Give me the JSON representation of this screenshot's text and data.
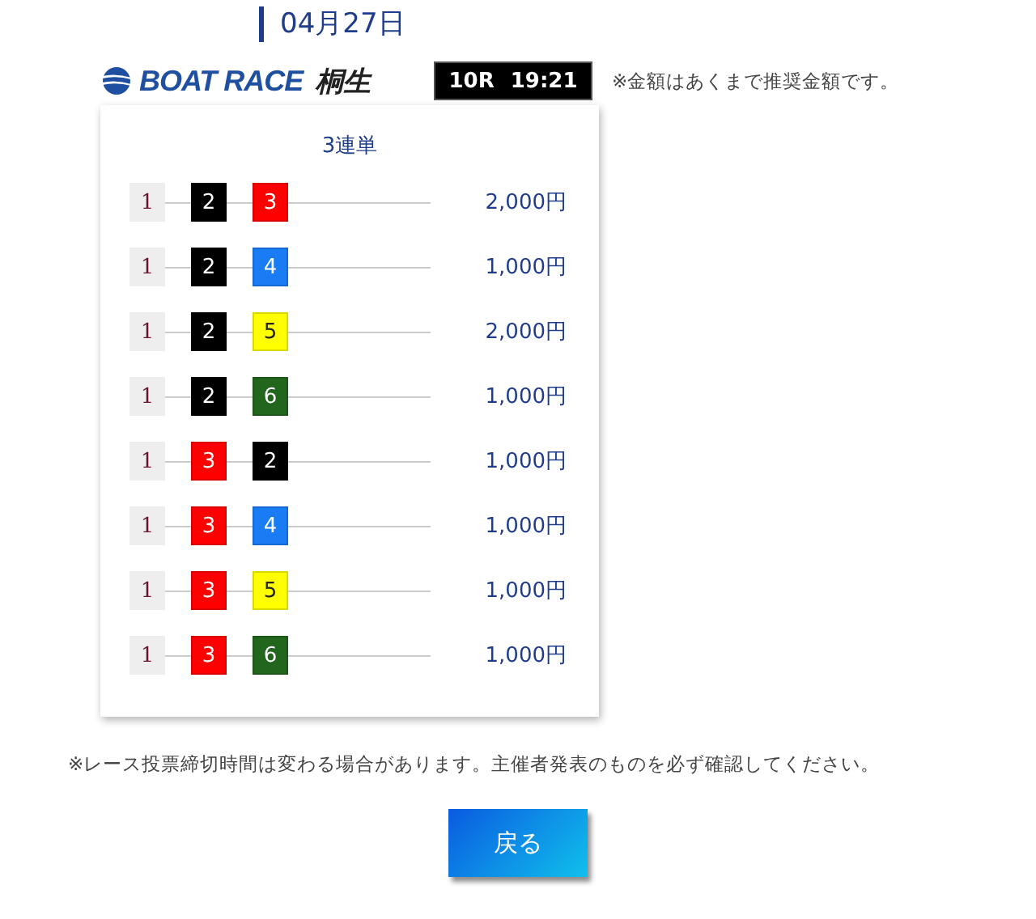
{
  "date": "04月27日",
  "venue": {
    "brand": "BOAT RACE",
    "name": "桐生"
  },
  "race": {
    "number": "10R",
    "time": "19:21"
  },
  "amount_note": "※金額はあくまで推奨金額です。",
  "card": {
    "title": "3連単",
    "bets": [
      {
        "boats": [
          {
            "number": "1",
            "color": "#eeeeee"
          },
          {
            "number": "2",
            "color": "#000000"
          },
          {
            "number": "3",
            "color": "#ff0000"
          }
        ],
        "amount": "2,000円"
      },
      {
        "boats": [
          {
            "number": "1",
            "color": "#eeeeee"
          },
          {
            "number": "2",
            "color": "#000000"
          },
          {
            "number": "4",
            "color": "#1a7cf5"
          }
        ],
        "amount": "1,000円"
      },
      {
        "boats": [
          {
            "number": "1",
            "color": "#eeeeee"
          },
          {
            "number": "2",
            "color": "#000000"
          },
          {
            "number": "5",
            "color": "#ffff00"
          }
        ],
        "amount": "2,000円"
      },
      {
        "boats": [
          {
            "number": "1",
            "color": "#eeeeee"
          },
          {
            "number": "2",
            "color": "#000000"
          },
          {
            "number": "6",
            "color": "#22661e"
          }
        ],
        "amount": "1,000円"
      },
      {
        "boats": [
          {
            "number": "1",
            "color": "#eeeeee"
          },
          {
            "number": "3",
            "color": "#ff0000"
          },
          {
            "number": "2",
            "color": "#000000"
          }
        ],
        "amount": "1,000円"
      },
      {
        "boats": [
          {
            "number": "1",
            "color": "#eeeeee"
          },
          {
            "number": "3",
            "color": "#ff0000"
          },
          {
            "number": "4",
            "color": "#1a7cf5"
          }
        ],
        "amount": "1,000円"
      },
      {
        "boats": [
          {
            "number": "1",
            "color": "#eeeeee"
          },
          {
            "number": "3",
            "color": "#ff0000"
          },
          {
            "number": "5",
            "color": "#ffff00"
          }
        ],
        "amount": "1,000円"
      },
      {
        "boats": [
          {
            "number": "1",
            "color": "#eeeeee"
          },
          {
            "number": "3",
            "color": "#ff0000"
          },
          {
            "number": "6",
            "color": "#22661e"
          }
        ],
        "amount": "1,000円"
      }
    ]
  },
  "deadline_note": "※レース投票締切時間は変わる場合があります。主催者発表のものを必ず確認してください。",
  "back_button": "戻る"
}
